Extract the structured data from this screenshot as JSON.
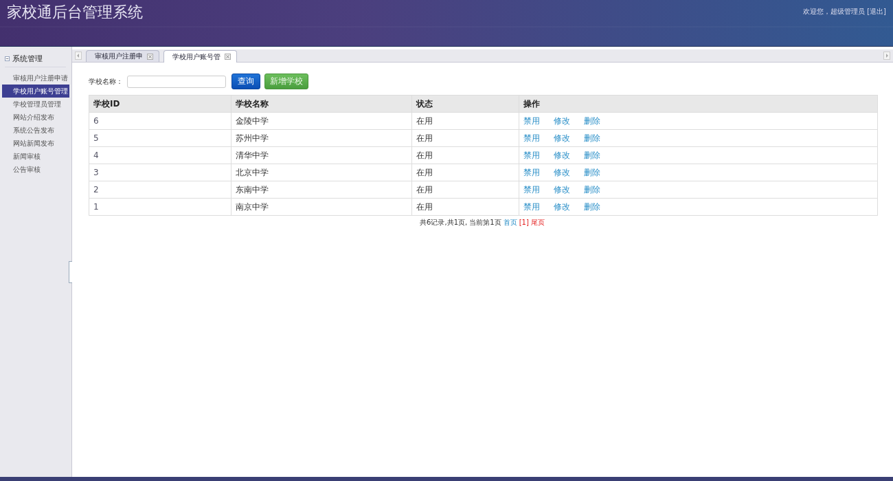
{
  "header": {
    "title": "家校通后台管理系统",
    "welcome": "欢迎您，超级管理员",
    "logout": "[退出]"
  },
  "sidebar": {
    "section": "系统管理",
    "expanded": true,
    "items": [
      {
        "label": "审核用户注册申请",
        "selected": false
      },
      {
        "label": "学校用户账号管理",
        "selected": true
      },
      {
        "label": "学校管理员管理",
        "selected": false
      },
      {
        "label": "网站介绍发布",
        "selected": false
      },
      {
        "label": "系统公告发布",
        "selected": false
      },
      {
        "label": "网站新闻发布",
        "selected": false
      },
      {
        "label": "新闻审核",
        "selected": false
      },
      {
        "label": "公告审核",
        "selected": false
      }
    ]
  },
  "tabs": [
    {
      "label": "审核用户注册申",
      "selected": false
    },
    {
      "label": "学校用户账号管",
      "selected": true
    }
  ],
  "search": {
    "label": "学校名称：",
    "button": "查询",
    "add_button": "新增学校"
  },
  "table": {
    "columns": [
      "学校ID",
      "学校名称",
      "状态",
      "操作"
    ],
    "rows": [
      {
        "id": "6",
        "name": "金陵中学",
        "status": "在用",
        "actions": [
          "禁用",
          "修改",
          "删除"
        ]
      },
      {
        "id": "5",
        "name": "苏州中学",
        "status": "在用",
        "actions": [
          "禁用",
          "修改",
          "删除"
        ]
      },
      {
        "id": "4",
        "name": "清华中学",
        "status": "在用",
        "actions": [
          "禁用",
          "修改",
          "删除"
        ]
      },
      {
        "id": "3",
        "name": "北京中学",
        "status": "在用",
        "actions": [
          "禁用",
          "修改",
          "删除"
        ]
      },
      {
        "id": "2",
        "name": "东南中学",
        "status": "在用",
        "actions": [
          "禁用",
          "修改",
          "删除"
        ]
      },
      {
        "id": "1",
        "name": "南京中学",
        "status": "在用",
        "actions": [
          "禁用",
          "修改",
          "删除"
        ]
      }
    ]
  },
  "pagination": {
    "summary": "共6记录,共1页, 当前第1页",
    "first": "首页",
    "current": "[1]",
    "last": "尾页"
  }
}
